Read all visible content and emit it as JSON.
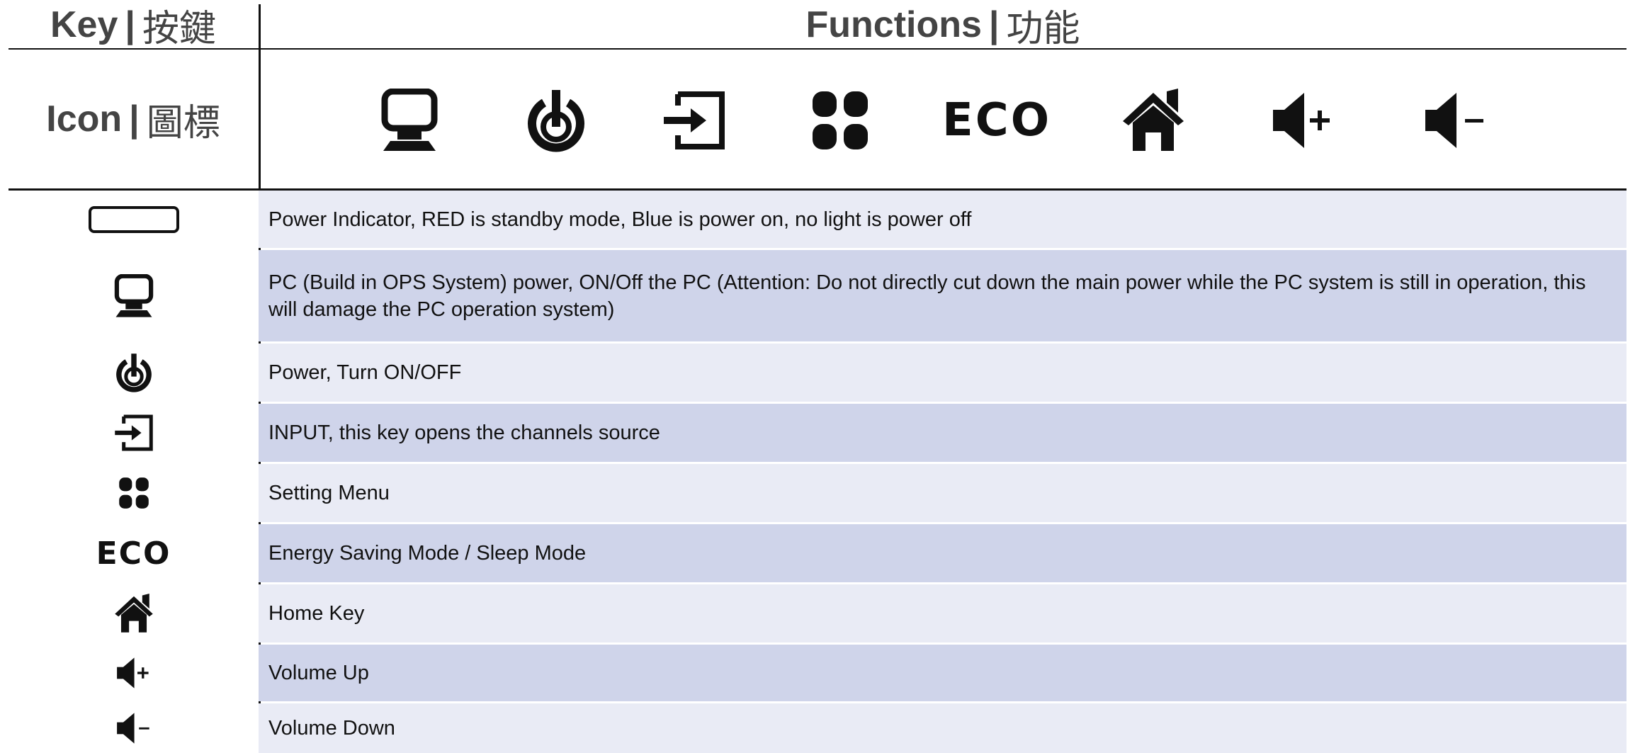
{
  "header": {
    "key_en": "Key",
    "key_zh": "按鍵",
    "functions_en": "Functions",
    "functions_zh": "功能",
    "separator": "|"
  },
  "icon_row": {
    "label_en": "Icon",
    "label_zh": "圖標",
    "icons": [
      "pc-monitor-icon",
      "power-icon",
      "input-source-icon",
      "menu-icon",
      "eco-icon",
      "home-icon",
      "volume-up-icon",
      "volume-down-icon"
    ],
    "eco_text": "ECO"
  },
  "rows": [
    {
      "icon": "power-indicator-icon",
      "description": "Power Indicator, RED is standby mode, Blue is power on, no light is power off"
    },
    {
      "icon": "pc-monitor-icon",
      "description": "PC (Build in OPS System) power,  ON/Off the PC (Attention: Do not directly cut down the main power while the PC system is still in operation, this will damage the PC operation system)"
    },
    {
      "icon": "power-icon",
      "description": "Power, Turn ON/OFF"
    },
    {
      "icon": "input-source-icon",
      "description": "INPUT, this key opens the channels source"
    },
    {
      "icon": "menu-icon",
      "description": "Setting Menu"
    },
    {
      "icon": "eco-icon",
      "description": "Energy Saving Mode / Sleep Mode"
    },
    {
      "icon": "home-icon",
      "description": "Home Key"
    },
    {
      "icon": "volume-up-icon",
      "description": "Volume Up"
    },
    {
      "icon": "volume-down-icon",
      "description": "Volume Down"
    }
  ]
}
